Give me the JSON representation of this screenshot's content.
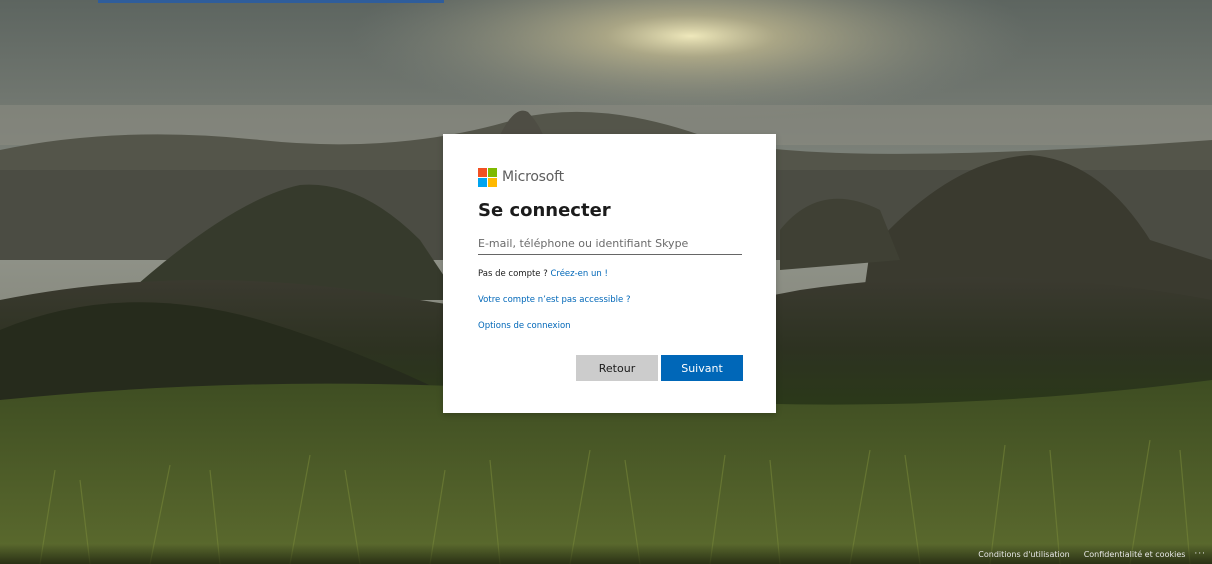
{
  "brand": {
    "name": "Microsoft",
    "logo_colors": [
      "#f25022",
      "#7fba00",
      "#00a4ef",
      "#ffb900"
    ]
  },
  "signin": {
    "title": "Se connecter",
    "email_placeholder": "E-mail, téléphone ou identifiant Skype",
    "email_value": "",
    "no_account_text": "Pas de compte ?",
    "create_link": "Créez-en un !",
    "inaccessible_link": "Votre compte n’est pas accessible ?",
    "signin_options_link": "Options de connexion",
    "back_button": "Retour",
    "next_button": "Suivant"
  },
  "footer": {
    "terms": "Conditions d'utilisation",
    "privacy": "Confidentialité et cookies",
    "more": "···"
  },
  "colors": {
    "accent": "#0067b8",
    "back_button": "#cccccc"
  }
}
